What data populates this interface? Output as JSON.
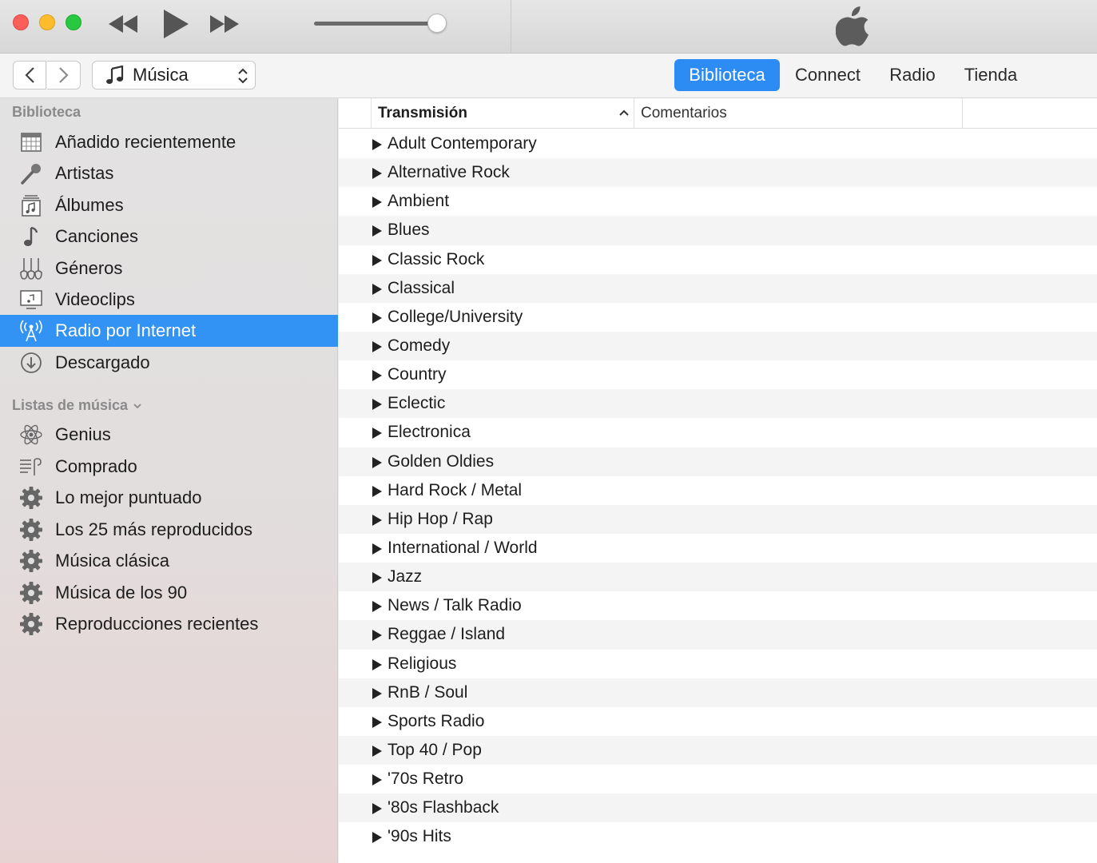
{
  "window": {
    "controls": [
      "close",
      "minimize",
      "zoom"
    ],
    "transport": {
      "rewind_icon": "rewind-icon",
      "play_icon": "play-icon",
      "forward_icon": "fast-forward-icon"
    },
    "volume_level": 0.9
  },
  "toolbar": {
    "media_select": "Música",
    "tabs": [
      {
        "label": "Biblioteca",
        "selected": true
      },
      {
        "label": "Connect",
        "selected": false
      },
      {
        "label": "Radio",
        "selected": false
      },
      {
        "label": "Tienda",
        "selected": false
      }
    ]
  },
  "sidebar": {
    "library_header": "Biblioteca",
    "library_items": [
      {
        "label": "Añadido recientemente",
        "icon": "calendar-grid-icon"
      },
      {
        "label": "Artistas",
        "icon": "microphone-icon"
      },
      {
        "label": "Álbumes",
        "icon": "album-stack-icon"
      },
      {
        "label": "Canciones",
        "icon": "music-note-icon"
      },
      {
        "label": "Géneros",
        "icon": "guitars-icon"
      },
      {
        "label": "Videoclips",
        "icon": "video-screen-icon"
      },
      {
        "label": "Radio por Internet",
        "icon": "broadcast-antenna-icon",
        "selected": true
      },
      {
        "label": "Descargado",
        "icon": "download-circle-icon"
      }
    ],
    "playlists_header": "Listas de música",
    "playlist_items": [
      {
        "label": "Genius",
        "icon": "genius-atom-icon"
      },
      {
        "label": "Comprado",
        "icon": "purchased-list-icon"
      },
      {
        "label": "Lo mejor puntuado",
        "icon": "gear-icon"
      },
      {
        "label": "Los 25 más reproducidos",
        "icon": "gear-icon"
      },
      {
        "label": "Música clásica",
        "icon": "gear-icon"
      },
      {
        "label": "Música de los 90",
        "icon": "gear-icon"
      },
      {
        "label": "Reproducciones recientes",
        "icon": "gear-icon"
      }
    ]
  },
  "main": {
    "columns": {
      "stream": "Transmisión",
      "comments": "Comentarios"
    },
    "sort": "ascending",
    "rows": [
      "Adult Contemporary",
      "Alternative Rock",
      "Ambient",
      "Blues",
      "Classic Rock",
      "Classical",
      "College/University",
      "Comedy",
      "Country",
      "Eclectic",
      "Electronica",
      "Golden Oldies",
      "Hard Rock / Metal",
      "Hip Hop / Rap",
      "International / World",
      "Jazz",
      "News / Talk Radio",
      "Reggae / Island",
      "Religious",
      "RnB / Soul",
      "Sports Radio",
      "Top 40 / Pop",
      "'70s Retro",
      "'80s Flashback",
      "'90s Hits"
    ]
  },
  "colors": {
    "accent": "#2d8cf4",
    "selection": "#3393f5",
    "close": "#fc5f57",
    "minimize": "#fdbc2e",
    "zoom": "#28c840"
  }
}
